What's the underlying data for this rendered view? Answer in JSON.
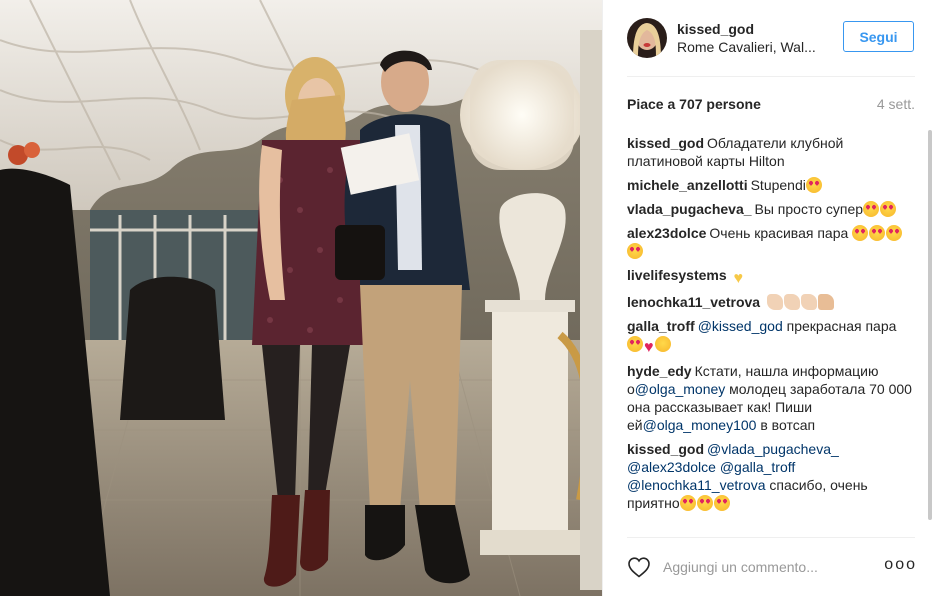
{
  "post": {
    "username": "kissed_god",
    "location": "Rome Cavalieri, Wal...",
    "follow_label": "Segui",
    "likes": "Piace a 707 persone",
    "time_ago": "4 sett."
  },
  "comments": [
    {
      "user": "kissed_god",
      "parts": [
        {
          "t": "Обладатели клубной платиновой карты Hilton"
        }
      ]
    },
    {
      "user": "michele_anzellotti",
      "parts": [
        {
          "t": "Stupendi"
        },
        {
          "e": "heart-eyes"
        }
      ]
    },
    {
      "user": "vlada_pugacheva_",
      "parts": [
        {
          "t": "Вы просто супер"
        },
        {
          "e": "heart-eyes"
        },
        {
          "e": "heart-eyes"
        }
      ]
    },
    {
      "user": "alex23dolce",
      "parts": [
        {
          "t": "Очень красивая пара "
        },
        {
          "e": "heart-eyes"
        },
        {
          "e": "heart-eyes"
        },
        {
          "e": "heart-eyes"
        },
        {
          "e": "heart-eyes"
        }
      ]
    },
    {
      "user": "livelifesystems",
      "parts": [
        {
          "t": " "
        },
        {
          "e": "yellow-heart"
        }
      ]
    },
    {
      "user": "lenochka11_vetrova",
      "parts": [
        {
          "t": " "
        },
        {
          "e": "clap"
        },
        {
          "e": "clap"
        },
        {
          "e": "clap"
        },
        {
          "e": "thumb"
        }
      ]
    },
    {
      "user": "galla_troff",
      "parts": [
        {
          "m": "@kissed_god"
        },
        {
          "t": " прекрасная пара "
        },
        {
          "e": "heart-eyes"
        },
        {
          "e": "red-heart"
        },
        {
          "e": "kiss"
        }
      ]
    },
    {
      "user": "hyde_edy",
      "parts": [
        {
          "t": "Кстати, нашла информацию о"
        },
        {
          "m": "@olga_money"
        },
        {
          "t": " молодец заработала 70 000 она рассказывает как! Пиши ей"
        },
        {
          "m": "@olga_money100"
        },
        {
          "t": " в вотсап"
        }
      ]
    },
    {
      "user": "kissed_god",
      "parts": [
        {
          "m": "@vlada_pugacheva_"
        },
        {
          "t": " "
        },
        {
          "m": "@alex23dolce"
        },
        {
          "t": " "
        },
        {
          "m": "@galla_troff"
        },
        {
          "t": " "
        },
        {
          "m": "@lenochka11_vetrova"
        },
        {
          "t": " спасибо, очень приятно"
        },
        {
          "e": "heart-eyes"
        },
        {
          "e": "heart-eyes"
        },
        {
          "e": "heart-eyes"
        }
      ]
    }
  ],
  "footer": {
    "comment_placeholder": "Aggiungi un commento...",
    "more_label": "ooo"
  },
  "colors": {
    "accent": "#3897f0",
    "mention": "#003569",
    "muted": "#999999",
    "text": "#262626"
  },
  "icons": {
    "like": "heart-outline-icon",
    "more": "more-options-icon"
  }
}
